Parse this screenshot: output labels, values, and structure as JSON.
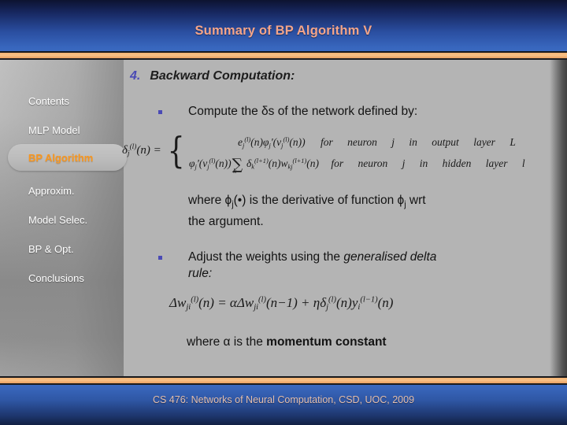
{
  "slide": {
    "title": "Summary of BP Algorithm V",
    "footer": "CS 476: Networks of Neural Computation, CSD, UOC, 2009"
  },
  "colors": {
    "header_top": "#0d1330",
    "header_bottom": "#3a69c0",
    "title_text": "#f4a58a",
    "rule_orange": "#f7c188",
    "body_bg": "#b4b4b4",
    "nav_text": "#ffffff",
    "nav_active_text": "#f79620",
    "bullet_marker": "#4a4ab5",
    "heading_number": "#4a4ab5",
    "body_text": "#131313",
    "footer_text": "#e3bfb0"
  },
  "sidebar": {
    "items": [
      {
        "label": "Contents",
        "active": false
      },
      {
        "label": "MLP Model",
        "active": false
      },
      {
        "label": "BP Algorithm",
        "active": true
      },
      {
        "label": "Approxim.",
        "active": false
      },
      {
        "label": "Model Selec.",
        "active": false
      },
      {
        "label": "BP & Opt.",
        "active": false
      },
      {
        "label": "Conclusions",
        "active": false
      }
    ]
  },
  "content": {
    "heading_number": "4.",
    "heading_text": "Backward Computation:",
    "bullet1": "Compute the δs of the network defined by:",
    "where_phi_line1_a": "where ϕ",
    "where_phi_line1_b": "j",
    "where_phi_line1_c": "(•) is the derivative of function ϕ",
    "where_phi_line1_d": "j",
    "where_phi_line1_e": " wrt",
    "where_phi_line2": "the argument.",
    "bullet2_plain": "Adjust the weights using the ",
    "bullet2_italic": "generalised delta",
    "bullet2_italic2": "rule:",
    "where_alpha_plain": "where α is the ",
    "where_alpha_bold": "momentum constant",
    "equation_delta": {
      "lhs": "δj(l)(n) =",
      "case_output": "ej(l)(n)ϕj'(vj(l)(n))   for neuron j in output layer L",
      "case_hidden": "ϕj'(vj(l)(n))∑k δk(l+1)(n)wkj(l+1)(n)   for neuron j in hidden layer l",
      "word_for": "for",
      "word_neuron": "neuron",
      "word_j": "j",
      "word_in": "in",
      "word_output": "output",
      "word_hidden": "hidden",
      "word_layer": "layer",
      "word_L": "L",
      "word_l": "l"
    },
    "equation_deltaw": "Δwji(l)(n) = αΔwji(l)(n−1) + ηδj(l)(n)yi(l−1)(n)"
  }
}
